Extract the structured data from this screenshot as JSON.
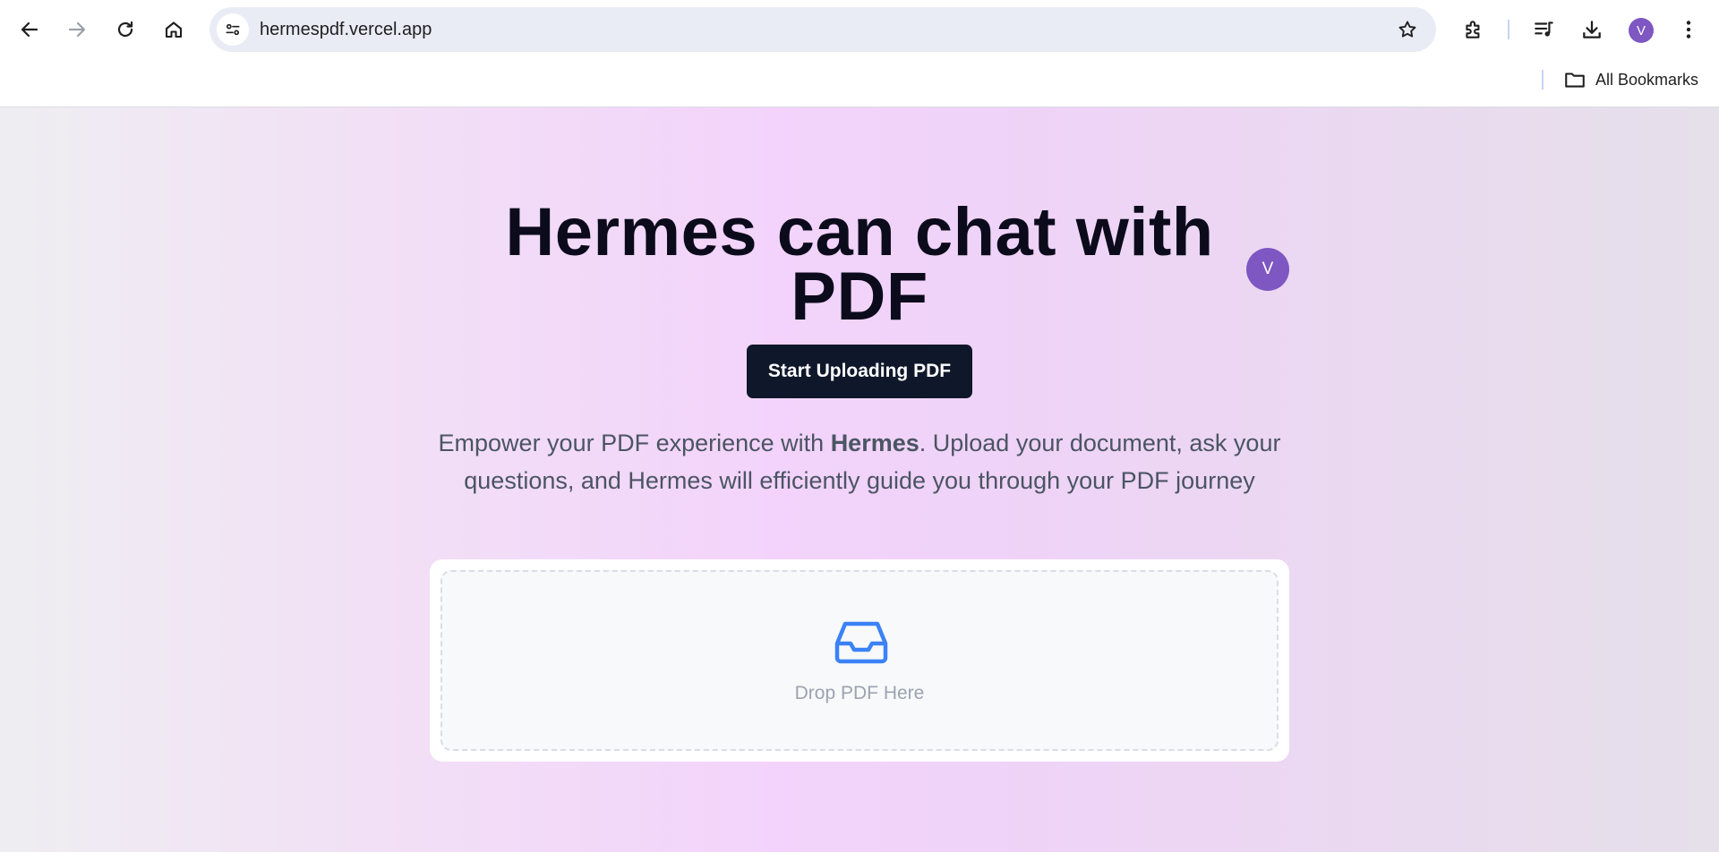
{
  "browser": {
    "url": "hermespdf.vercel.app",
    "profile_initial": "V",
    "bookmarks_label": "All Bookmarks",
    "icons": [
      "back-icon",
      "forward-icon",
      "reload-icon",
      "home-icon",
      "site-info-icon",
      "star-icon",
      "extensions-icon",
      "reading-list-icon",
      "download-icon",
      "more-icon",
      "folder-icon"
    ]
  },
  "hero": {
    "headline": "Hermes can chat with PDF",
    "avatar_initial": "V",
    "cta_label": "Start Uploading PDF",
    "tagline_prefix": "Empower your PDF experience with ",
    "tagline_brand": "Hermes",
    "tagline_suffix": ". Upload your document, ask your questions, and Hermes will efficiently guide you through your PDF journey"
  },
  "upload": {
    "drop_label": "Drop PDF Here",
    "icon": "inbox-icon"
  },
  "colors": {
    "accent": "#7e57c2",
    "cta_bg": "#0f172a",
    "icon_blue": "#3b82f6"
  }
}
